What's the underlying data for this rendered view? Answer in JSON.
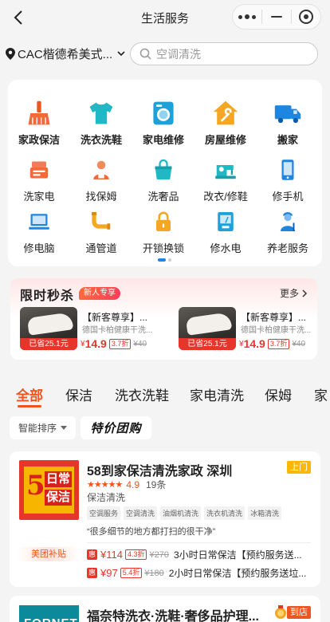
{
  "header": {
    "title": "生活服务"
  },
  "location": {
    "text": "CAC楷德希美式..."
  },
  "search": {
    "placeholder": "空调清洗"
  },
  "categories": [
    {
      "label": "家政保洁",
      "icon": "broom-icon"
    },
    {
      "label": "洗衣洗鞋",
      "icon": "tshirt-icon"
    },
    {
      "label": "家电维修",
      "icon": "washing-machine-icon"
    },
    {
      "label": "房屋维修",
      "icon": "house-wrench-icon"
    },
    {
      "label": "搬家",
      "icon": "truck-icon"
    },
    {
      "label": "洗家电",
      "icon": "appliance-clean-icon"
    },
    {
      "label": "找保姆",
      "icon": "nanny-icon"
    },
    {
      "label": "洗奢品",
      "icon": "luxury-bag-icon"
    },
    {
      "label": "改衣/修鞋",
      "icon": "sewing-machine-icon"
    },
    {
      "label": "修手机",
      "icon": "phone-icon"
    },
    {
      "label": "修电脑",
      "icon": "computer-icon"
    },
    {
      "label": "通管道",
      "icon": "pipe-icon"
    },
    {
      "label": "开锁换锁",
      "icon": "lock-icon"
    },
    {
      "label": "修水电",
      "icon": "meter-icon"
    },
    {
      "label": "养老服务",
      "icon": "elder-icon"
    }
  ],
  "flash_sale": {
    "title": "限时秒杀",
    "badge": "新人专享",
    "more": "更多",
    "deals": [
      {
        "save": "已省25.1元",
        "name": "【新客尊享】...",
        "sub": "德国卡柏健康干洗...",
        "cny": "¥",
        "price": "14.9",
        "discount": "3.7折",
        "orig": "¥40"
      },
      {
        "save": "已省25.1元",
        "name": "【新客尊享】...",
        "sub": "德国卡柏健康干洗...",
        "cny": "¥",
        "price": "14.9",
        "discount": "3.7折",
        "orig": "¥40"
      }
    ]
  },
  "tabs": [
    "全部",
    "保洁",
    "洗衣洗鞋",
    "家电清洗",
    "保姆",
    "家"
  ],
  "filters": {
    "sort": "智能排序",
    "group_buy": "特价团购"
  },
  "shop1": {
    "logo_number": "5",
    "logo_text1": "日常",
    "logo_text2": "保洁",
    "name": "58到家保洁清洗家政 深圳",
    "door_tag": "上门",
    "stars": "★★★★★",
    "rating": "4.9",
    "reviews": "19条",
    "category": "保洁清洗",
    "chips": [
      "空调服务",
      "空调清洗",
      "油烟机清洗",
      "洗衣机清洗",
      "冰箱清洗"
    ],
    "review": "“很多细节的地方都打扫的很干净”",
    "subsidy": "美团补贴",
    "deals": [
      {
        "hui": "惠",
        "price": "¥114",
        "discount": "4.3折",
        "orig": "¥270",
        "title": "3小时日常保洁【预约服务送..."
      },
      {
        "hui": "惠",
        "price": "¥97",
        "discount": "5.4折",
        "orig": "¥180",
        "title": "2小时日常保洁【预约服务送垃..."
      }
    ]
  },
  "shop2": {
    "logo_text": "FORNET",
    "name": "福奈特洗衣·洗鞋·奢侈品护理...",
    "store_tag": "到店"
  },
  "colors": {
    "accent": "#f0551f",
    "price_red": "#e8352b",
    "door_yellow": "#ffb800"
  }
}
